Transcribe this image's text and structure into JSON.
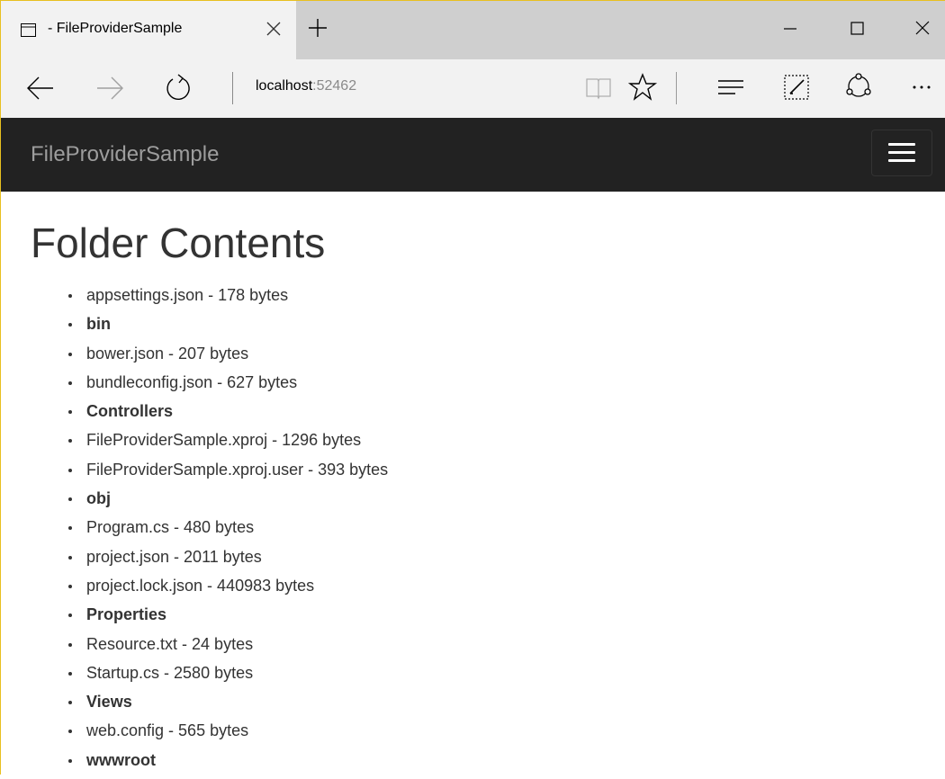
{
  "browser": {
    "tab_title": "- FileProviderSample",
    "url_host": "localhost",
    "url_port": ":52462"
  },
  "navbar": {
    "brand": "FileProviderSample"
  },
  "page": {
    "heading": "Folder Contents",
    "items": [
      {
        "text": "appsettings.json - 178 bytes",
        "type": "file"
      },
      {
        "text": "bin",
        "type": "folder"
      },
      {
        "text": "bower.json - 207 bytes",
        "type": "file"
      },
      {
        "text": "bundleconfig.json - 627 bytes",
        "type": "file"
      },
      {
        "text": "Controllers",
        "type": "folder"
      },
      {
        "text": "FileProviderSample.xproj - 1296 bytes",
        "type": "file"
      },
      {
        "text": "FileProviderSample.xproj.user - 393 bytes",
        "type": "file"
      },
      {
        "text": "obj",
        "type": "folder"
      },
      {
        "text": "Program.cs - 480 bytes",
        "type": "file"
      },
      {
        "text": "project.json - 2011 bytes",
        "type": "file"
      },
      {
        "text": "project.lock.json - 440983 bytes",
        "type": "file"
      },
      {
        "text": "Properties",
        "type": "folder"
      },
      {
        "text": "Resource.txt - 24 bytes",
        "type": "file"
      },
      {
        "text": "Startup.cs - 2580 bytes",
        "type": "file"
      },
      {
        "text": "Views",
        "type": "folder"
      },
      {
        "text": "web.config - 565 bytes",
        "type": "file"
      },
      {
        "text": "wwwroot",
        "type": "folder"
      }
    ]
  }
}
